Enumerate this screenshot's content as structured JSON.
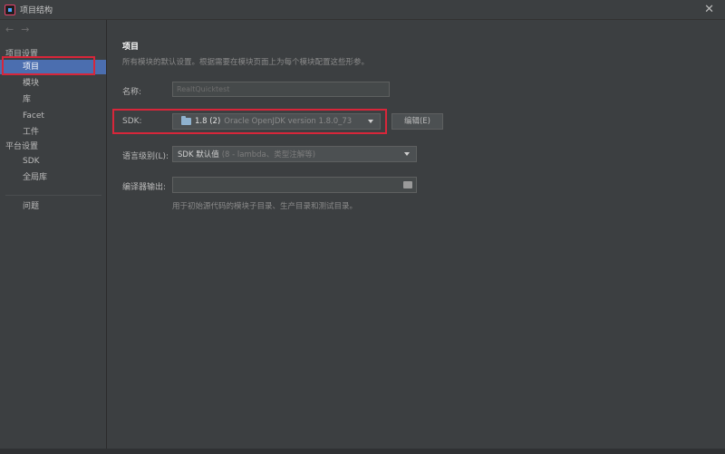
{
  "window": {
    "title": "项目结构",
    "close_glyph": "✕"
  },
  "sidebar": {
    "back_glyph": "←",
    "forward_glyph": "→",
    "project_settings_header": "项目设置",
    "project_items": [
      "项目",
      "模块",
      "库",
      "Facet",
      "工件"
    ],
    "platform_settings_header": "平台设置",
    "platform_items": [
      "SDK",
      "全局库"
    ],
    "problems_label": "问题",
    "selected_item": "项目"
  },
  "main": {
    "heading": "项目",
    "description": "所有模块的默认设置。根据需要在模块页面上为每个模块配置这些形参。",
    "name_label": "名称:",
    "name_value": "RealtQuicktest",
    "sdk_label": "SDK:",
    "sdk_value": "1.8 (2)",
    "sdk_description": "Oracle OpenJDK version 1.8.0_73",
    "edit_button": "编辑(E)",
    "language_level_label": "语言级别(L):",
    "language_level_value": "SDK 默认值",
    "language_level_hint": "(8 - lambda、类型注解等)",
    "compiler_output_label": "编译器输出:",
    "compiler_output_value": "",
    "compiler_output_hint": "用于初始源代码的模块子目录、生产目录和测试目录。"
  },
  "colors": {
    "background": "#3c3f41",
    "selection": "#4b6eaf",
    "highlight_box": "#d8263a"
  }
}
